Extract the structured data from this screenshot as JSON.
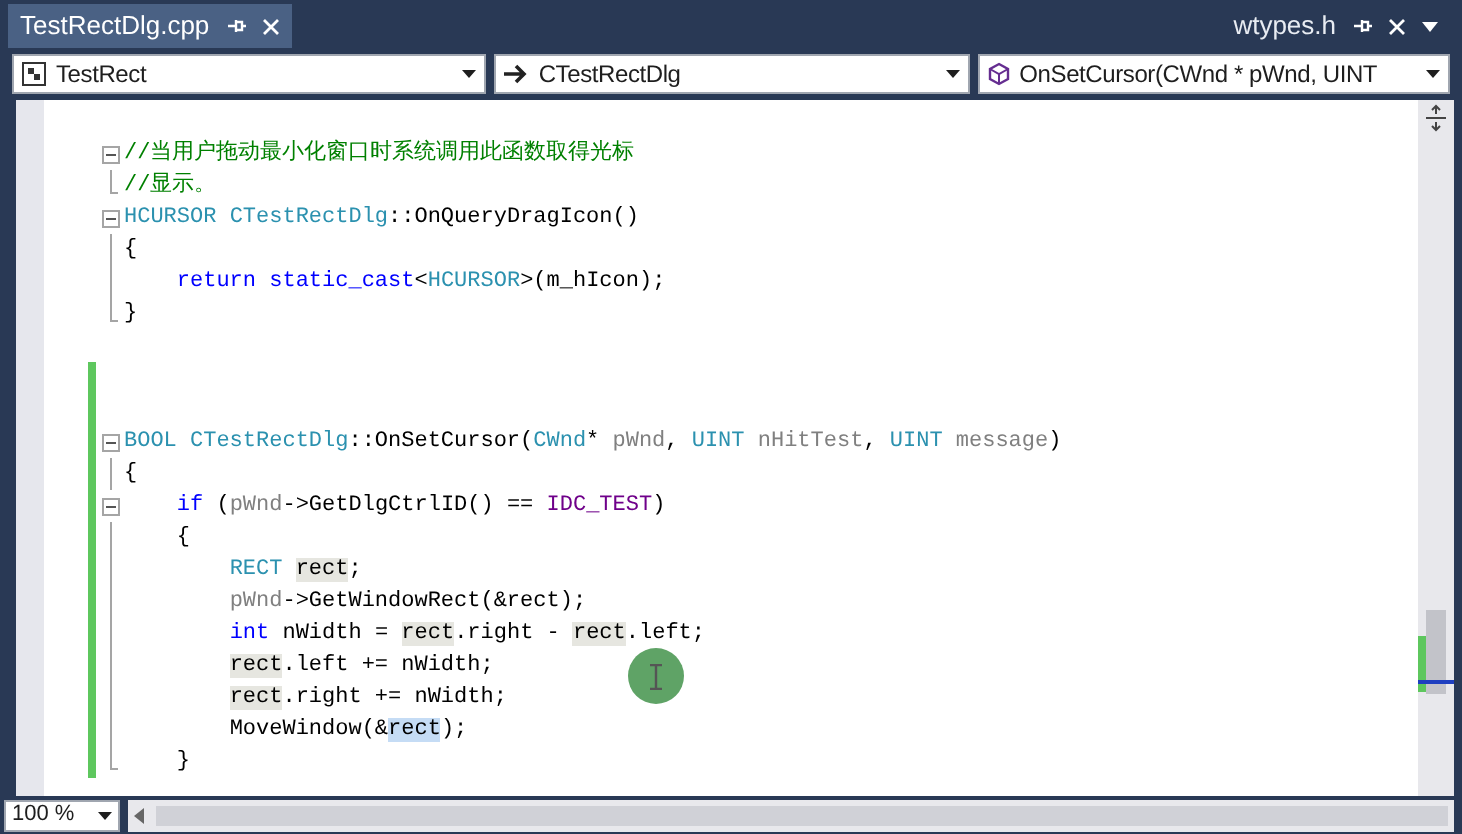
{
  "tabs": [
    {
      "label": "TestRectDlg.cpp",
      "selected": true
    },
    {
      "label": "wtypes.h",
      "selected": false
    }
  ],
  "navigation_bar": [
    {
      "kind": "project",
      "label": "TestRect"
    },
    {
      "kind": "class",
      "label": "CTestRectDlg"
    },
    {
      "kind": "method",
      "label": "OnSetCursor(CWnd * pWnd, UINT"
    }
  ],
  "code_lines": [
    {
      "kind": "fold_start",
      "changed": false,
      "tokens": [
        {
          "kind": "comment",
          "text": "//当用户拖动最小化窗口时系统调用此函数取得光标"
        }
      ]
    },
    {
      "kind": "fold_end",
      "changed": false,
      "tokens": [
        {
          "kind": "comment",
          "text": "//显示。"
        }
      ]
    },
    {
      "kind": "fold_start",
      "changed": false,
      "tokens": [
        {
          "kind": "type",
          "text": "HCURSOR "
        },
        {
          "kind": "type",
          "text": "CTestRectDlg"
        },
        {
          "kind": "plain",
          "text": "::OnQueryDragIcon()"
        }
      ]
    },
    {
      "kind": "fold_body",
      "changed": false,
      "tokens": [
        {
          "kind": "plain",
          "text": "{"
        }
      ]
    },
    {
      "kind": "fold_body",
      "changed": false,
      "tokens": [
        {
          "kind": "keyword",
          "text": "    return static_cast"
        },
        {
          "kind": "plain",
          "text": "<"
        },
        {
          "kind": "type",
          "text": "HCURSOR"
        },
        {
          "kind": "plain",
          "text": ">(m_hIcon);"
        }
      ]
    },
    {
      "kind": "fold_end",
      "changed": false,
      "tokens": [
        {
          "kind": "plain",
          "text": "}"
        }
      ]
    },
    {
      "kind": "blank",
      "changed": false
    },
    {
      "kind": "blank",
      "changed": true
    },
    {
      "kind": "blank",
      "changed": true
    },
    {
      "kind": "fold_start",
      "changed": true,
      "tokens": [
        {
          "kind": "type",
          "text": "BOOL CTestRectDlg"
        },
        {
          "kind": "plain",
          "text": "::OnSetCursor("
        },
        {
          "kind": "type",
          "text": "CWnd"
        },
        {
          "kind": "plain",
          "text": "* "
        },
        {
          "kind": "param",
          "text": "pWnd"
        },
        {
          "kind": "plain",
          "text": ", "
        },
        {
          "kind": "type",
          "text": "UINT"
        },
        {
          "kind": "param",
          "text": " nHitTest"
        },
        {
          "kind": "plain",
          "text": ", "
        },
        {
          "kind": "type",
          "text": "UINT"
        },
        {
          "kind": "param",
          "text": " message"
        },
        {
          "kind": "plain",
          "text": ")"
        }
      ]
    },
    {
      "kind": "fold_body",
      "changed": true,
      "tokens": [
        {
          "kind": "plain",
          "text": "{"
        }
      ]
    },
    {
      "kind": "fold_start",
      "changed": true,
      "tokens": [
        {
          "kind": "keyword",
          "text": "    if"
        },
        {
          "kind": "plain",
          "text": " ("
        },
        {
          "kind": "param",
          "text": "pWnd"
        },
        {
          "kind": "plain",
          "text": "->GetDlgCtrlID() == "
        },
        {
          "kind": "macro",
          "text": "IDC_TEST"
        },
        {
          "kind": "plain",
          "text": ")"
        }
      ]
    },
    {
      "kind": "fold_body",
      "changed": true,
      "tokens": [
        {
          "kind": "plain",
          "text": "    {"
        }
      ]
    },
    {
      "kind": "fold_body",
      "changed": true,
      "tokens": [
        {
          "kind": "type",
          "text": "        RECT "
        },
        {
          "kind": "reference",
          "text": "rect"
        },
        {
          "kind": "plain",
          "text": ";"
        }
      ]
    },
    {
      "kind": "fold_body",
      "changed": true,
      "tokens": [
        {
          "kind": "param",
          "text": "        pWnd"
        },
        {
          "kind": "plain",
          "text": "->GetWindowRect(&rect);"
        }
      ]
    },
    {
      "kind": "fold_body",
      "changed": true,
      "tokens": [
        {
          "kind": "keyword",
          "text": "        int"
        },
        {
          "kind": "plain",
          "text": " nWidth = "
        },
        {
          "kind": "reference",
          "text": "rect"
        },
        {
          "kind": "plain",
          "text": ".right - "
        },
        {
          "kind": "reference",
          "text": "rect"
        },
        {
          "kind": "plain",
          "text": ".left;"
        }
      ]
    },
    {
      "kind": "fold_body",
      "changed": true,
      "tokens": [
        {
          "kind": "reference",
          "text": "        rect"
        },
        {
          "kind": "plain",
          "text": ".left += nWidth;"
        }
      ]
    },
    {
      "kind": "fold_body",
      "changed": true,
      "tokens": [
        {
          "kind": "reference",
          "text": "        rect"
        },
        {
          "kind": "plain",
          "text": ".right += nWidth;"
        }
      ]
    },
    {
      "kind": "fold_body",
      "changed": true,
      "tokens": [
        {
          "kind": "plain",
          "text": "        MoveWindow(&"
        },
        {
          "kind": "selected",
          "text": "rect"
        },
        {
          "kind": "plain",
          "text": ");"
        }
      ]
    },
    {
      "kind": "fold_end",
      "changed": true,
      "tokens": [
        {
          "kind": "plain",
          "text": "    }"
        }
      ]
    }
  ],
  "zoom": {
    "value": "100 %"
  }
}
